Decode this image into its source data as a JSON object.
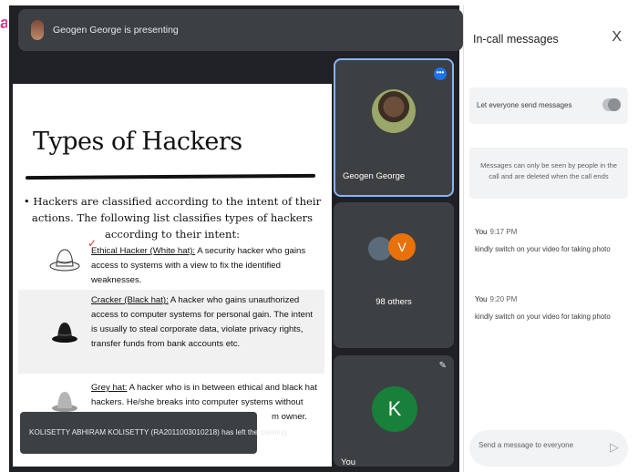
{
  "edge_mark": "a",
  "presenter": {
    "text": "Geogen George is presenting"
  },
  "slide": {
    "title": "Types of Hackers",
    "intro": "• Hackers are classified according to the intent of their actions. The following list classifies types of hackers according to their intent:",
    "items": [
      {
        "name": "Ethical Hacker (White hat):",
        "desc": " A security hacker who gains access to systems with a view to fix the identified weaknesses."
      },
      {
        "name": "Cracker (Black hat):",
        "desc": " A hacker who gains unauthorized access to computer systems for personal gain. The intent is usually to steal corporate data, violate privacy rights, transfer funds from bank accounts etc."
      },
      {
        "name": "Grey hat:",
        "desc": " A hacker who is in between ethical and black hat hackers. He/she breaks into computer systems without authority with a view"
      },
      {
        "tail": "m owner."
      }
    ]
  },
  "tiles": {
    "main_name": "Geogen George",
    "more_icon": "more-vert-icon",
    "group_initial": "V",
    "others": "98 others",
    "self_initial": "K",
    "self_name": "You"
  },
  "toast": "KOLISETTY ABHIRAM KOLISETTY (RA2011003010218) has left the meeting",
  "chat": {
    "title": "In-call messages",
    "close": "X",
    "toggle_label": "Let everyone send messages",
    "info": "Messages can only be seen by people in the call and are deleted when the call ends",
    "messages": [
      {
        "sender": "You",
        "time": "9:17 PM",
        "text": "kindly switch on your video for taking photo"
      },
      {
        "sender": "You",
        "time": "9:20 PM",
        "text": "kindly switch on your video for taking photo"
      }
    ],
    "placeholder": "Send a message to everyone",
    "send_icon": "send-icon"
  }
}
